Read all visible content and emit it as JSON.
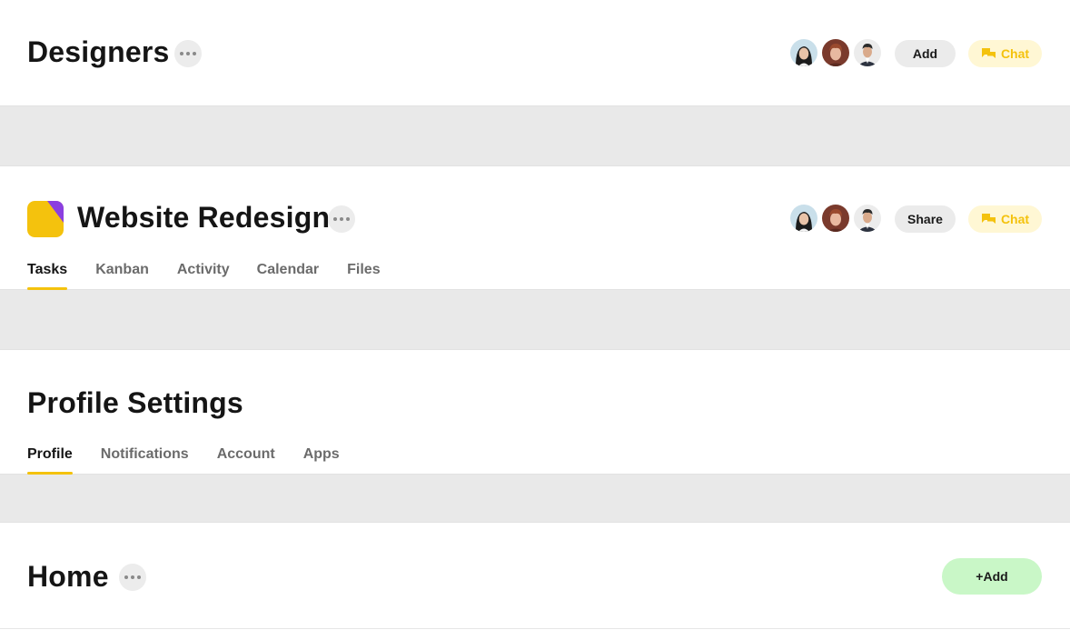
{
  "colors": {
    "accent_yellow": "#f4c20d",
    "chat_bg": "#fff7d4",
    "band_gray": "#e9e9e9",
    "green_button": "#c9f7c7",
    "logo_purple": "#8b3fe0"
  },
  "designers": {
    "title": "Designers",
    "add_label": "Add",
    "chat_label": "Chat",
    "avatars": [
      "avatar-woman",
      "avatar-man-red-hair",
      "avatar-man-dark-suit"
    ]
  },
  "project": {
    "title": "Website Redesign",
    "share_label": "Share",
    "chat_label": "Chat",
    "tabs": [
      "Tasks",
      "Kanban",
      "Activity",
      "Calendar",
      "Files"
    ],
    "active_tab": "Tasks"
  },
  "profile": {
    "title": "Profile Settings",
    "tabs": [
      "Profile",
      "Notifications",
      "Account",
      "Apps"
    ],
    "active_tab": "Profile"
  },
  "home": {
    "title": "Home",
    "add_label": "+Add"
  },
  "icons": [
    "more-icon",
    "chat-icon",
    "app-logo-icon"
  ]
}
